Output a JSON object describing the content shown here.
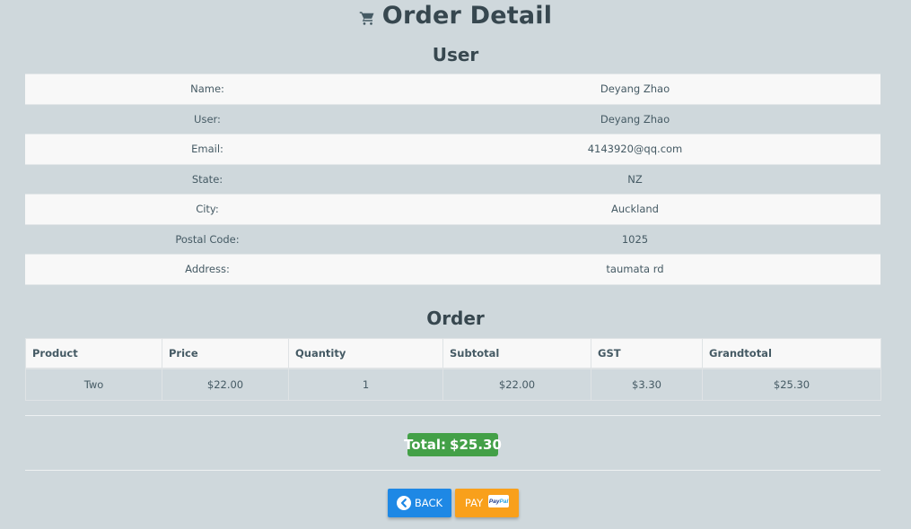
{
  "header": {
    "icon": "cart-icon",
    "title": "Order Detail"
  },
  "user_section": {
    "title": "User",
    "rows": [
      {
        "label": "Name:",
        "value": "Deyang Zhao"
      },
      {
        "label": "User:",
        "value": "Deyang Zhao"
      },
      {
        "label": "Email:",
        "value": "4143920@qq.com"
      },
      {
        "label": "State:",
        "value": "NZ"
      },
      {
        "label": "City:",
        "value": "Auckland"
      },
      {
        "label": "Postal Code:",
        "value": "1025"
      },
      {
        "label": "Address:",
        "value": "taumata rd"
      }
    ]
  },
  "order_section": {
    "title": "Order",
    "columns": [
      "Product",
      "Price",
      "Quantity",
      "Subtotal",
      "GST",
      "Grandtotal"
    ],
    "rows": [
      [
        "Two",
        "$22.00",
        "1",
        "$22.00",
        "$3.30",
        "$25.30"
      ]
    ]
  },
  "total": {
    "label": "Total:",
    "value": "$25.30",
    "color": "#43a047"
  },
  "actions": {
    "back_label": "BACK",
    "back_icon": "chevron-left-circle-icon",
    "back_color": "#1e88e5",
    "pay_label": "PAY",
    "pay_icon": "paypal-icon",
    "pay_icon_text_1": "Pay",
    "pay_icon_text_2": "Pal",
    "pay_color": "#f9a01b"
  },
  "colors": {
    "background": "#cfd8dc",
    "text": "#455a64",
    "row_stripe": "#f8f8f8"
  }
}
